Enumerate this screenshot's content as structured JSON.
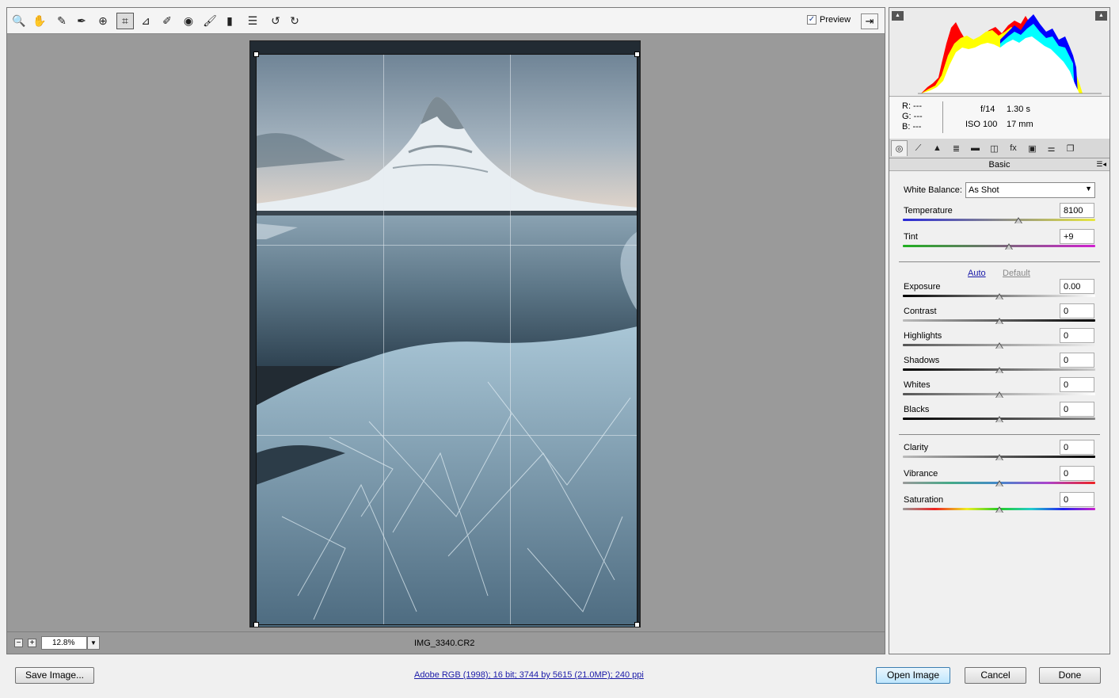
{
  "toolbar": {
    "tools": [
      {
        "name": "zoom-tool",
        "icon": "magnifier-icon",
        "glyph": "🔍"
      },
      {
        "name": "hand-tool",
        "icon": "hand-icon",
        "glyph": "✋"
      },
      {
        "name": "white-balance-tool",
        "icon": "eyedropper-icon",
        "glyph": "✎"
      },
      {
        "name": "color-sampler-tool",
        "icon": "color-sampler-icon",
        "glyph": "✒"
      },
      {
        "name": "targeted-adjustment-tool",
        "icon": "target-adjust-icon",
        "glyph": "⊕"
      },
      {
        "name": "crop-tool",
        "icon": "crop-icon",
        "glyph": "⌗"
      },
      {
        "name": "straighten-tool",
        "icon": "straighten-icon",
        "glyph": "⊿"
      },
      {
        "name": "spot-removal-tool",
        "icon": "spot-removal-icon",
        "glyph": "✐"
      },
      {
        "name": "red-eye-tool",
        "icon": "red-eye-icon",
        "glyph": "◉"
      },
      {
        "name": "adjustment-brush-tool",
        "icon": "brush-icon",
        "glyph": "🖌"
      },
      {
        "name": "graduated-filter-tool",
        "icon": "graduated-filter-icon",
        "glyph": "▮"
      },
      {
        "name": "preferences-tool",
        "icon": "list-icon",
        "glyph": "☰"
      },
      {
        "name": "rotate-left-tool",
        "icon": "rotate-ccw-icon",
        "glyph": "↺"
      },
      {
        "name": "rotate-right-tool",
        "icon": "rotate-cw-icon",
        "glyph": "↻"
      }
    ],
    "active_tool": "crop-tool",
    "preview_label": "Preview",
    "preview_checked": true,
    "fullscreen_icon": "fullscreen-icon"
  },
  "status": {
    "zoom_value": "12.8%",
    "filename": "IMG_3340.CR2"
  },
  "readout": {
    "r": "R:  ---",
    "g": "G:  ---",
    "b": "B:  ---",
    "aperture": "f/14",
    "shutter": "1.30 s",
    "iso": "ISO 100",
    "focal": "17 mm"
  },
  "panel": {
    "title": "Basic",
    "tabs": [
      "basic-tab-icon",
      "tone-curve-tab-icon",
      "detail-tab-icon",
      "hsl-tab-icon",
      "split-toning-tab-icon",
      "lens-corrections-tab-icon",
      "effects-tab-icon",
      "camera-calibration-tab-icon",
      "presets-tab-icon",
      "snapshots-tab-icon"
    ],
    "white_balance_label": "White Balance:",
    "white_balance_value": "As Shot",
    "auto_label": "Auto",
    "default_label": "Default",
    "sliders": [
      {
        "key": "temperature",
        "label": "Temperature",
        "value": "8100",
        "position": 0.6
      },
      {
        "key": "tint",
        "label": "Tint",
        "value": "+9",
        "position": 0.55
      },
      {
        "key": "exposure",
        "label": "Exposure",
        "value": "0.00",
        "position": 0.5
      },
      {
        "key": "contrast",
        "label": "Contrast",
        "value": "0",
        "position": 0.5
      },
      {
        "key": "highlights",
        "label": "Highlights",
        "value": "0",
        "position": 0.5
      },
      {
        "key": "shadows",
        "label": "Shadows",
        "value": "0",
        "position": 0.5
      },
      {
        "key": "whites",
        "label": "Whites",
        "value": "0",
        "position": 0.5
      },
      {
        "key": "blacks",
        "label": "Blacks",
        "value": "0",
        "position": 0.5
      },
      {
        "key": "clarity",
        "label": "Clarity",
        "value": "0",
        "position": 0.5
      },
      {
        "key": "vibrance",
        "label": "Vibrance",
        "value": "0",
        "position": 0.5
      },
      {
        "key": "saturation",
        "label": "Saturation",
        "value": "0",
        "position": 0.5
      }
    ]
  },
  "footer": {
    "save_label": "Save Image...",
    "info_link": "Adobe RGB (1998); 16 bit; 3744 by 5615 (21.0MP); 240 ppi",
    "open_label": "Open Image",
    "cancel_label": "Cancel",
    "done_label": "Done"
  }
}
